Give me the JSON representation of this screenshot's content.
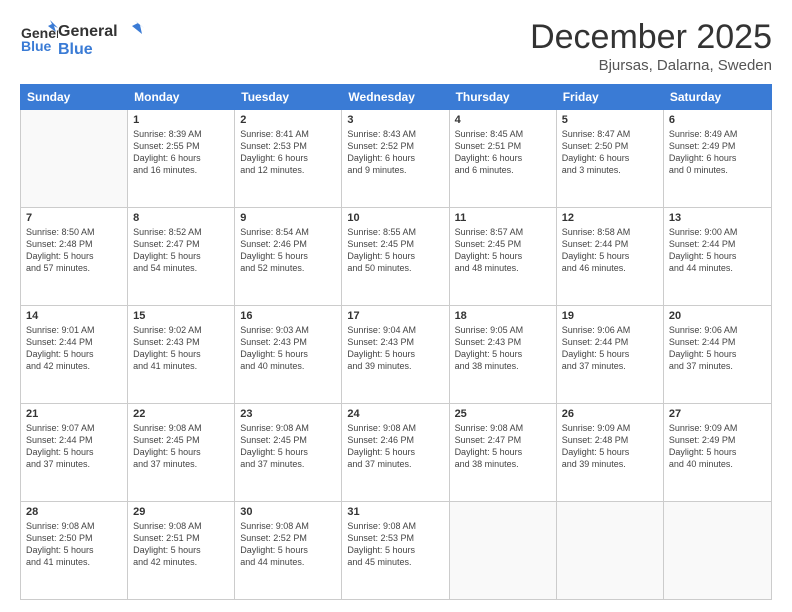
{
  "header": {
    "logo_general": "General",
    "logo_blue": "Blue",
    "month": "December 2025",
    "location": "Bjursas, Dalarna, Sweden"
  },
  "days_of_week": [
    "Sunday",
    "Monday",
    "Tuesday",
    "Wednesday",
    "Thursday",
    "Friday",
    "Saturday"
  ],
  "weeks": [
    [
      {
        "day": "",
        "info": ""
      },
      {
        "day": "1",
        "info": "Sunrise: 8:39 AM\nSunset: 2:55 PM\nDaylight: 6 hours\nand 16 minutes."
      },
      {
        "day": "2",
        "info": "Sunrise: 8:41 AM\nSunset: 2:53 PM\nDaylight: 6 hours\nand 12 minutes."
      },
      {
        "day": "3",
        "info": "Sunrise: 8:43 AM\nSunset: 2:52 PM\nDaylight: 6 hours\nand 9 minutes."
      },
      {
        "day": "4",
        "info": "Sunrise: 8:45 AM\nSunset: 2:51 PM\nDaylight: 6 hours\nand 6 minutes."
      },
      {
        "day": "5",
        "info": "Sunrise: 8:47 AM\nSunset: 2:50 PM\nDaylight: 6 hours\nand 3 minutes."
      },
      {
        "day": "6",
        "info": "Sunrise: 8:49 AM\nSunset: 2:49 PM\nDaylight: 6 hours\nand 0 minutes."
      }
    ],
    [
      {
        "day": "7",
        "info": "Sunrise: 8:50 AM\nSunset: 2:48 PM\nDaylight: 5 hours\nand 57 minutes."
      },
      {
        "day": "8",
        "info": "Sunrise: 8:52 AM\nSunset: 2:47 PM\nDaylight: 5 hours\nand 54 minutes."
      },
      {
        "day": "9",
        "info": "Sunrise: 8:54 AM\nSunset: 2:46 PM\nDaylight: 5 hours\nand 52 minutes."
      },
      {
        "day": "10",
        "info": "Sunrise: 8:55 AM\nSunset: 2:45 PM\nDaylight: 5 hours\nand 50 minutes."
      },
      {
        "day": "11",
        "info": "Sunrise: 8:57 AM\nSunset: 2:45 PM\nDaylight: 5 hours\nand 48 minutes."
      },
      {
        "day": "12",
        "info": "Sunrise: 8:58 AM\nSunset: 2:44 PM\nDaylight: 5 hours\nand 46 minutes."
      },
      {
        "day": "13",
        "info": "Sunrise: 9:00 AM\nSunset: 2:44 PM\nDaylight: 5 hours\nand 44 minutes."
      }
    ],
    [
      {
        "day": "14",
        "info": "Sunrise: 9:01 AM\nSunset: 2:44 PM\nDaylight: 5 hours\nand 42 minutes."
      },
      {
        "day": "15",
        "info": "Sunrise: 9:02 AM\nSunset: 2:43 PM\nDaylight: 5 hours\nand 41 minutes."
      },
      {
        "day": "16",
        "info": "Sunrise: 9:03 AM\nSunset: 2:43 PM\nDaylight: 5 hours\nand 40 minutes."
      },
      {
        "day": "17",
        "info": "Sunrise: 9:04 AM\nSunset: 2:43 PM\nDaylight: 5 hours\nand 39 minutes."
      },
      {
        "day": "18",
        "info": "Sunrise: 9:05 AM\nSunset: 2:43 PM\nDaylight: 5 hours\nand 38 minutes."
      },
      {
        "day": "19",
        "info": "Sunrise: 9:06 AM\nSunset: 2:44 PM\nDaylight: 5 hours\nand 37 minutes."
      },
      {
        "day": "20",
        "info": "Sunrise: 9:06 AM\nSunset: 2:44 PM\nDaylight: 5 hours\nand 37 minutes."
      }
    ],
    [
      {
        "day": "21",
        "info": "Sunrise: 9:07 AM\nSunset: 2:44 PM\nDaylight: 5 hours\nand 37 minutes."
      },
      {
        "day": "22",
        "info": "Sunrise: 9:08 AM\nSunset: 2:45 PM\nDaylight: 5 hours\nand 37 minutes."
      },
      {
        "day": "23",
        "info": "Sunrise: 9:08 AM\nSunset: 2:45 PM\nDaylight: 5 hours\nand 37 minutes."
      },
      {
        "day": "24",
        "info": "Sunrise: 9:08 AM\nSunset: 2:46 PM\nDaylight: 5 hours\nand 37 minutes."
      },
      {
        "day": "25",
        "info": "Sunrise: 9:08 AM\nSunset: 2:47 PM\nDaylight: 5 hours\nand 38 minutes."
      },
      {
        "day": "26",
        "info": "Sunrise: 9:09 AM\nSunset: 2:48 PM\nDaylight: 5 hours\nand 39 minutes."
      },
      {
        "day": "27",
        "info": "Sunrise: 9:09 AM\nSunset: 2:49 PM\nDaylight: 5 hours\nand 40 minutes."
      }
    ],
    [
      {
        "day": "28",
        "info": "Sunrise: 9:08 AM\nSunset: 2:50 PM\nDaylight: 5 hours\nand 41 minutes."
      },
      {
        "day": "29",
        "info": "Sunrise: 9:08 AM\nSunset: 2:51 PM\nDaylight: 5 hours\nand 42 minutes."
      },
      {
        "day": "30",
        "info": "Sunrise: 9:08 AM\nSunset: 2:52 PM\nDaylight: 5 hours\nand 44 minutes."
      },
      {
        "day": "31",
        "info": "Sunrise: 9:08 AM\nSunset: 2:53 PM\nDaylight: 5 hours\nand 45 minutes."
      },
      {
        "day": "",
        "info": ""
      },
      {
        "day": "",
        "info": ""
      },
      {
        "day": "",
        "info": ""
      }
    ]
  ]
}
